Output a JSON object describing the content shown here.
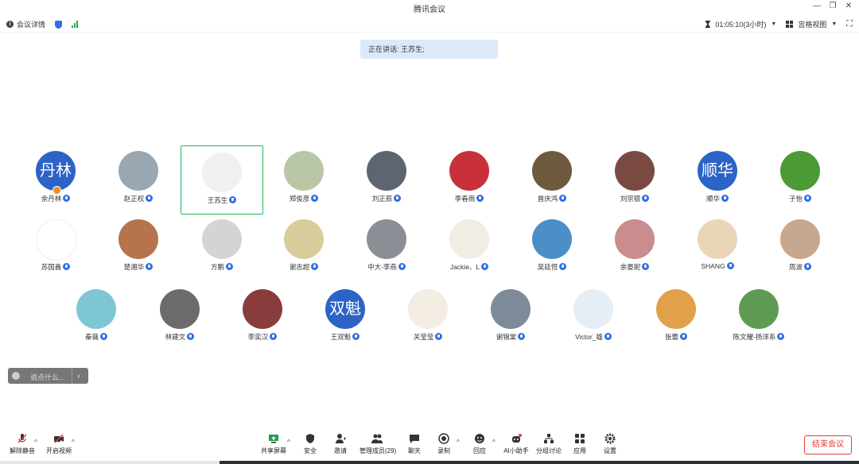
{
  "window": {
    "title": "腾讯会议"
  },
  "infobar": {
    "meeting_details": "会议详情",
    "timer": "01:05:10(3小时)",
    "view_mode": "宫格视图"
  },
  "speaking": {
    "label": "正在讲话: 王苏生;"
  },
  "participants": [
    {
      "name": "余丹林",
      "avatar_text": "丹林",
      "color": "#2b63c6"
    },
    {
      "name": "赵正权",
      "avatar_text": "",
      "color": "#9aa6b0"
    },
    {
      "name": "王苏生",
      "avatar_text": "",
      "color": "#f0f0f0"
    },
    {
      "name": "郑俊彦",
      "avatar_text": "",
      "color": "#b9c7a6"
    },
    {
      "name": "刘正辰",
      "avatar_text": "",
      "color": "#5c6570"
    },
    {
      "name": "李春雨",
      "avatar_text": "",
      "color": "#c9313a"
    },
    {
      "name": "曾庆鸿",
      "avatar_text": "",
      "color": "#6d5a3e"
    },
    {
      "name": "刘宗银",
      "avatar_text": "",
      "color": "#7a4a42"
    },
    {
      "name": "顺华",
      "avatar_text": "顺华",
      "color": "#2b63c6"
    },
    {
      "name": "子怡",
      "avatar_text": "",
      "color": "#4c9a36"
    },
    {
      "name": "苏国鑫",
      "avatar_text": "",
      "color": "#ffffff"
    },
    {
      "name": "楚湘华",
      "avatar_text": "",
      "color": "#b5734e"
    },
    {
      "name": "方鹏",
      "avatar_text": "",
      "color": "#d4d4d4"
    },
    {
      "name": "谢志超",
      "avatar_text": "",
      "color": "#d8cc9a"
    },
    {
      "name": "中大-李燕",
      "avatar_text": "",
      "color": "#8a8f96"
    },
    {
      "name": "Jackie、L",
      "avatar_text": "",
      "color": "#f1ece4"
    },
    {
      "name": "吴廷恒",
      "avatar_text": "",
      "color": "#4a8fc7"
    },
    {
      "name": "余晏妮",
      "avatar_text": "",
      "color": "#c98d8d"
    },
    {
      "name": "SHANG",
      "avatar_text": "",
      "color": "#e9d6b8"
    },
    {
      "name": "周波",
      "avatar_text": "",
      "color": "#c7a88f"
    },
    {
      "name": "秦薇",
      "avatar_text": "",
      "color": "#7ec6d4"
    },
    {
      "name": "林建文",
      "avatar_text": "",
      "color": "#6b6b6b"
    },
    {
      "name": "李奕汉",
      "avatar_text": "",
      "color": "#8a3b3b"
    },
    {
      "name": "王双魁",
      "avatar_text": "双魁",
      "color": "#2b63c6"
    },
    {
      "name": "关莹莹",
      "avatar_text": "",
      "color": "#f3ede3"
    },
    {
      "name": "谢锦棠",
      "avatar_text": "",
      "color": "#7d8a98"
    },
    {
      "name": "Victor_雄",
      "avatar_text": "",
      "color": "#e6eef5"
    },
    {
      "name": "张蕾",
      "avatar_text": "",
      "color": "#e2a04a"
    },
    {
      "name": "陈文耀-扬洋系",
      "avatar_text": "",
      "color": "#5f9a52"
    }
  ],
  "chat": {
    "placeholder": "说点什么...",
    "collapse": "‹"
  },
  "toolbar": {
    "unmute": "解除静音",
    "start_video": "开启视频",
    "share_screen": "共享屏幕",
    "security": "安全",
    "invite": "邀请",
    "manage_members": "管理成员(29)",
    "chat": "聊天",
    "record": "录制",
    "react": "回应",
    "ai_assistant": "AI小助手",
    "breakout": "分组讨论",
    "apps": "应用",
    "settings": "设置",
    "end_meeting": "结束会议"
  }
}
